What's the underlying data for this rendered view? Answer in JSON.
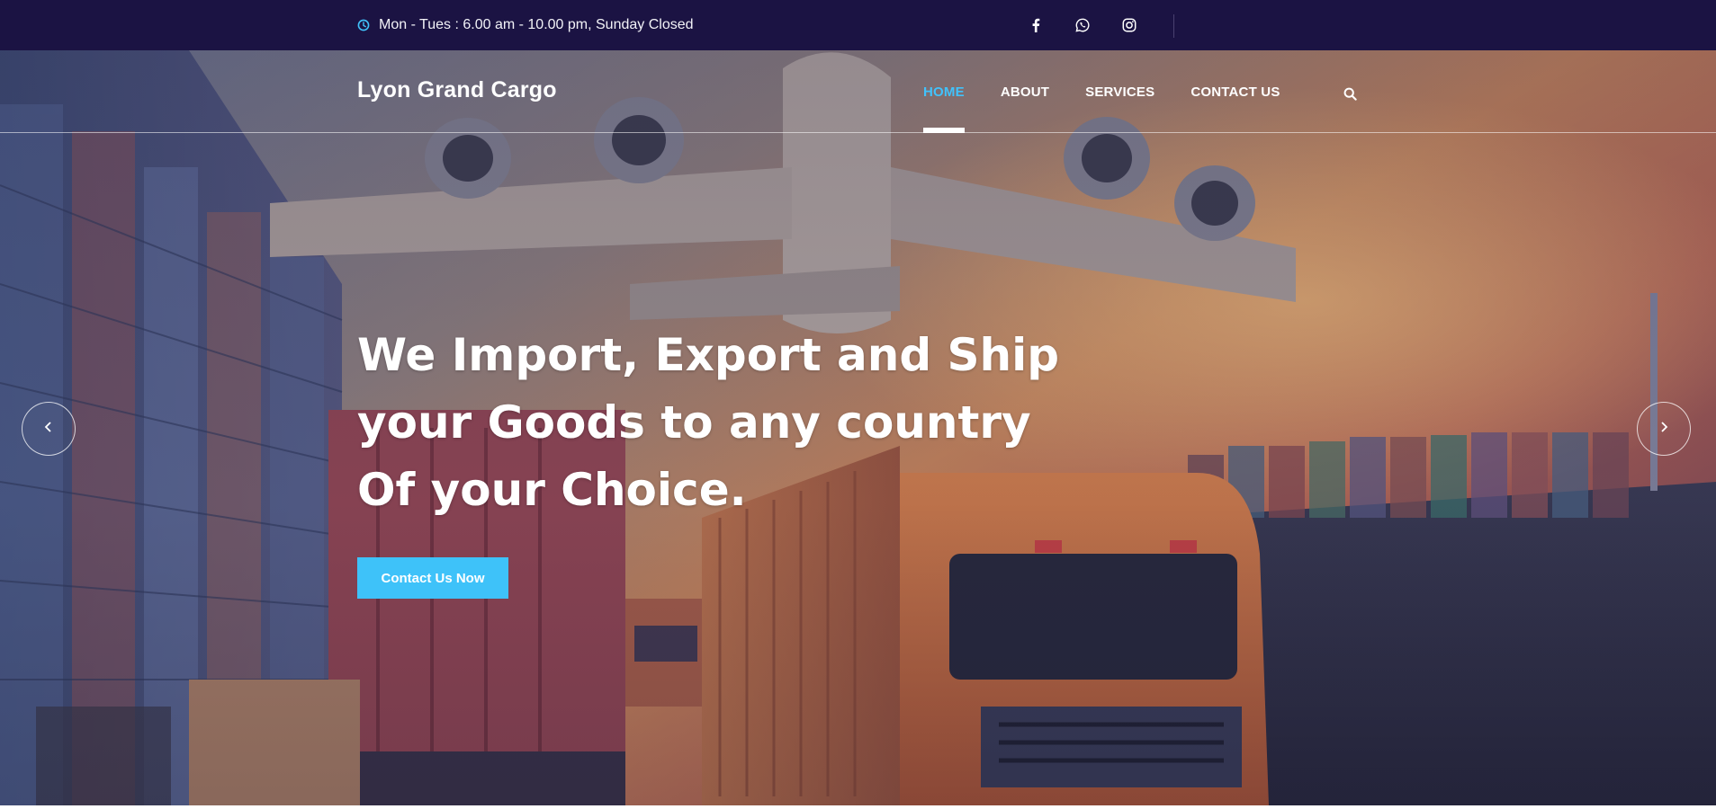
{
  "topbar": {
    "hours_icon": "clock-icon",
    "hours_text": "Mon - Tues : 6.00 am - 10.00 pm, Sunday Closed",
    "socials": [
      {
        "name": "facebook-icon"
      },
      {
        "name": "whatsapp-icon"
      },
      {
        "name": "instagram-icon"
      }
    ]
  },
  "header": {
    "brand": "Lyon Grand Cargo",
    "nav": [
      {
        "label": "HOME",
        "active": true
      },
      {
        "label": "ABOUT",
        "active": false
      },
      {
        "label": "SERVICES",
        "active": false
      },
      {
        "label": "CONTACT US",
        "active": false
      }
    ],
    "search_icon": "search-icon"
  },
  "hero": {
    "headline": "We Import, Export and Ship your Goods to any country Of your Choice.",
    "cta_label": "Contact Us Now",
    "prev_icon": "chevron-left-icon",
    "next_icon": "chevron-right-icon"
  },
  "colors": {
    "topbar_bg": "#1b1343",
    "accent": "#3ec2f9",
    "active_nav": "#41c2fb",
    "text": "#ffffff"
  }
}
